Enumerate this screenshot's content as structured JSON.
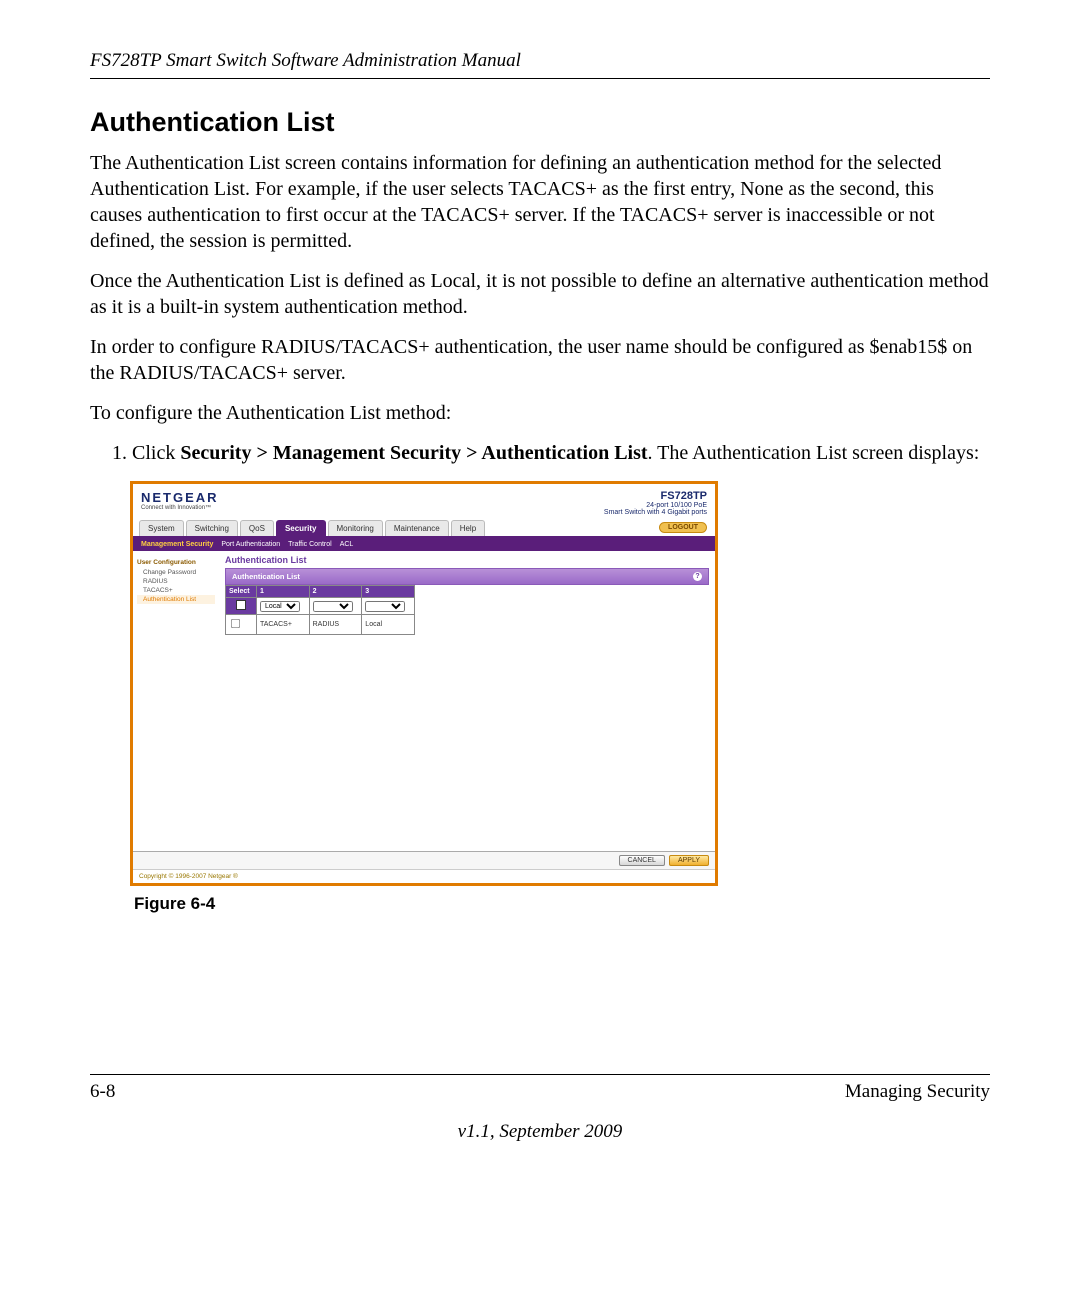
{
  "header": {
    "running": "FS728TP Smart Switch Software Administration Manual"
  },
  "section": {
    "title": "Authentication List",
    "p1": "The Authentication List screen contains information for defining an authentication method for the selected Authentication List. For example, if the user selects TACACS+ as the first entry, None as the second, this causes authentication to first occur at the TACACS+ server. If the TACACS+ server is inaccessible or not defined, the session is permitted.",
    "p2": "Once the Authentication List is defined as Local, it is not possible to define an alternative authentication method as it is a built-in system authentication method.",
    "p3": "In order to configure RADIUS/TACACS+ authentication, the user name should be configured as $enab15$ on the RADIUS/TACACS+ server.",
    "p4": "To configure the Authentication List method:",
    "step1_prefix": "Click ",
    "step1_bold": "Security > Management Security > Authentication List",
    "step1_suffix": ". The Authentication List screen displays:"
  },
  "screenshot": {
    "brand": {
      "logo": "NETGEAR",
      "tagline": "Connect with Innovation™"
    },
    "model": {
      "name": "FS728TP",
      "sub1": "24-port 10/100 PoE",
      "sub2": "Smart Switch with 4 Gigabit ports"
    },
    "tabs": [
      "System",
      "Switching",
      "QoS",
      "Security",
      "Monitoring",
      "Maintenance",
      "Help"
    ],
    "tabs_active_index": 3,
    "logout": "LOGOUT",
    "subtabs": [
      "Management Security",
      "Port Authentication",
      "Traffic Control",
      "ACL"
    ],
    "subtabs_active_index": 0,
    "sidebar": {
      "group": "User Configuration",
      "items": [
        "Change Password",
        "RADIUS",
        "TACACS+",
        "Authentication List"
      ],
      "active_index": 3
    },
    "panel": {
      "title": "Authentication List",
      "header": "Authentication List",
      "cols": [
        "Select",
        "1",
        "2",
        "3"
      ],
      "row1": {
        "c1": "Local",
        "c2": "",
        "c3": ""
      },
      "row2": {
        "c1": "TACACS+",
        "c2": "RADIUS",
        "c3": "Local"
      }
    },
    "footer": {
      "cancel": "CANCEL",
      "apply": "APPLY"
    },
    "copyright": "Copyright © 1996-2007 Netgear ®"
  },
  "figure": {
    "caption": "Figure 6-4"
  },
  "page_footer": {
    "left": "6-8",
    "right": "Managing Security",
    "version": "v1.1, September 2009"
  }
}
